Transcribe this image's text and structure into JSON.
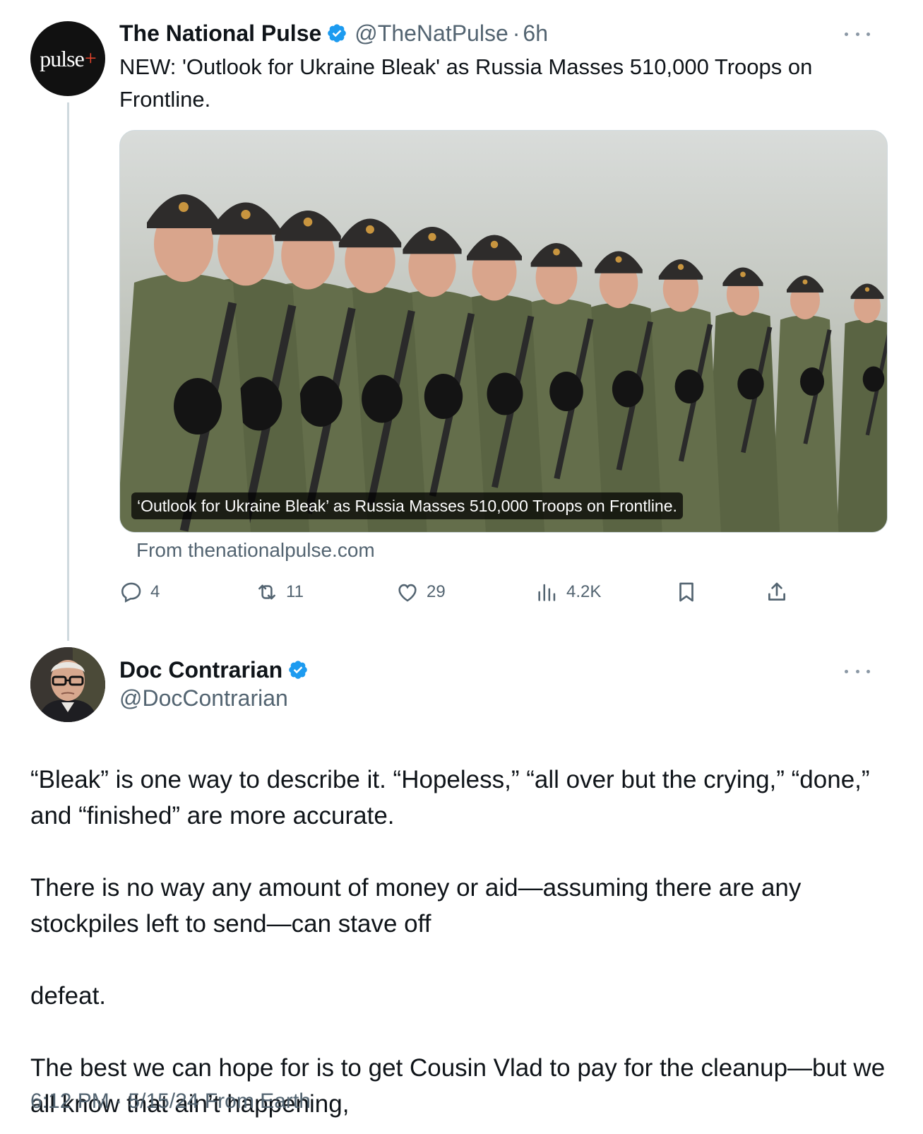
{
  "parent_tweet": {
    "avatar_text": "pulse",
    "avatar_plus": "+",
    "author_name": "The National Pulse",
    "handle": "@TheNatPulse",
    "separator": "·",
    "time": "6h",
    "text": "NEW: 'Outlook for Ukraine Bleak' as Russia Masses 510,000 Troops on Frontline.",
    "media": {
      "caption": "‘Outlook for Ukraine Bleak’ as Russia Masses 510,000 Troops on Frontline.",
      "icon": "soldiers-photo"
    },
    "source": "From thenationalpulse.com",
    "actions": {
      "replies": "4",
      "reposts": "11",
      "likes": "29",
      "views": "4.2K"
    }
  },
  "reply_tweet": {
    "author_name": "Doc Contrarian",
    "handle": "@DocContrarian",
    "paragraphs": [
      "“Bleak” is one way to describe it. “Hopeless,” “all over but the crying,” “done,” and “finished” are more accurate.",
      "There is no way any amount of money or aid—assuming there are any stockpiles left to send—can stave off",
      "defeat.",
      "The best we can hope for is to get Cousin Vlad to pay for the cleanup—but we all know that ain’t happening,"
    ],
    "flag_icon": "ukraine-flag-icon",
    "footer_time": "6:12 PM",
    "footer_separator": "·",
    "footer_date": "5/15/24",
    "footer_location": "From Earth"
  },
  "colors": {
    "primary_text": "#0f1419",
    "secondary_text": "#536471",
    "verified_blue": "#1d9bf0",
    "thread_line": "#cfd9de"
  }
}
